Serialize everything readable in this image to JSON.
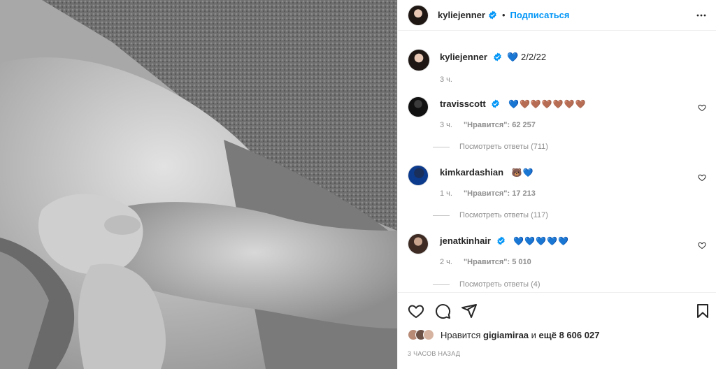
{
  "post": {
    "username": "kyliejenner",
    "separator": "•",
    "follow_label": "Подписаться",
    "caption": {
      "username": "kyliejenner",
      "text": "💙 2/2/22",
      "time": "3 ч."
    }
  },
  "comments": [
    {
      "username": "travisscott",
      "text": "💙🤎🤎🤎🤎🤎🤎",
      "time": "3 ч.",
      "likes": "\"Нравится\": 62 257",
      "replies": "Посмотреть ответы (711)"
    },
    {
      "username": "kimkardashian",
      "text": "🐻💙",
      "time": "1 ч.",
      "likes": "\"Нравится\": 17 213",
      "replies": "Посмотреть ответы (117)"
    },
    {
      "username": "jenatkinhair",
      "text": "💙💙💙💙💙",
      "time": "2 ч.",
      "likes": "\"Нравится\": 5 010",
      "replies": "Посмотреть ответы (4)"
    }
  ],
  "footer": {
    "likes_prefix": "Нравится",
    "likes_user": "gigiamiraa",
    "likes_mid": "и",
    "likes_count": "ещё 8 606 027",
    "date": "3 ЧАСОВ НАЗАД"
  },
  "icons": {
    "verified": "verified-badge-icon",
    "more": "more-horizontal-icon",
    "like": "heart-icon",
    "comment": "comment-icon",
    "share": "share-icon",
    "save": "bookmark-icon"
  },
  "colors": {
    "accent": "#0095f6",
    "verified": "#0095f6",
    "muted": "#8e8e8e"
  }
}
